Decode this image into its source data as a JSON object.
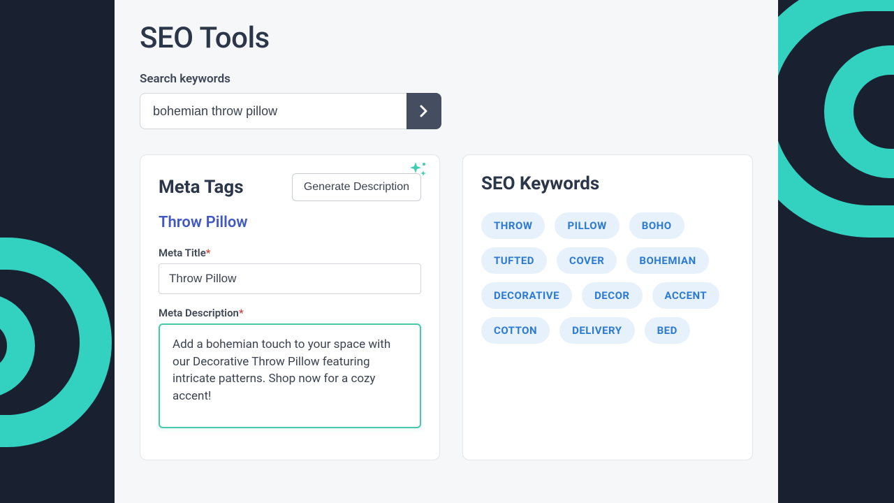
{
  "page": {
    "title": "SEO Tools"
  },
  "search": {
    "label": "Search keywords",
    "value": "bohemian throw pillow"
  },
  "meta_tags": {
    "panel_title": "Meta Tags",
    "generate_label": "Generate Description",
    "product_name": "Throw Pillow",
    "title_label": "Meta Title",
    "title_value": "Throw Pillow",
    "desc_label": "Meta Description",
    "desc_value": "Add a bohemian touch to your space with our Decorative Throw Pillow featuring intricate patterns. Shop now for a cozy accent!"
  },
  "keywords": {
    "panel_title": "SEO Keywords",
    "items": [
      "THROW",
      "PILLOW",
      "BOHO",
      "TUFTED",
      "COVER",
      "BOHEMIAN",
      "DECORATIVE",
      "DECOR",
      "ACCENT",
      "COTTON",
      "DELIVERY",
      "BED"
    ]
  },
  "colors": {
    "accent_teal": "#33D1BF",
    "background_dark": "#19202F",
    "link_blue": "#4259C2",
    "description_border": "#46C8A9",
    "chip_bg": "#E6F1FC",
    "chip_fg": "#2C7AD2"
  }
}
